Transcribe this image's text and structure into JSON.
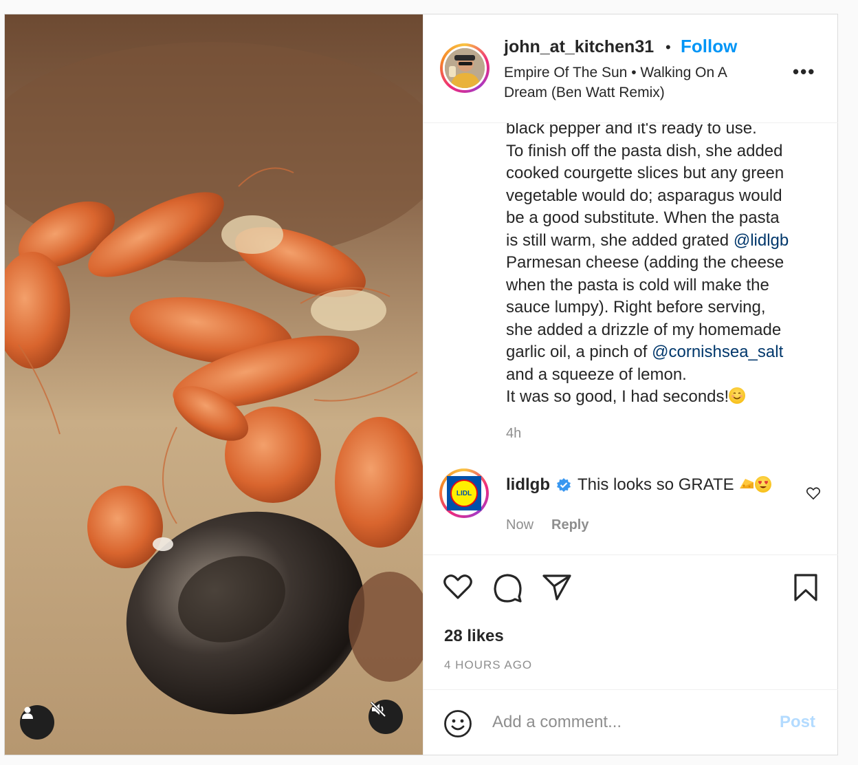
{
  "header": {
    "username": "john_at_kitchen31",
    "separator": "•",
    "follow_label": "Follow",
    "music": "Empire Of The Sun • Walking On A Dream (Ben Watt Remix)",
    "more_label": "•••"
  },
  "caption": {
    "lines": [
      "black pepper and it's ready to use.",
      "To finish off the pasta dish, she added",
      "cooked courgette slices but any green",
      "vegetable would do; asparagus would",
      "be a good substitute. When the pasta"
    ],
    "line6_pre": "is still warm, she added grated ",
    "mention1": "@lidlgb",
    "line7": "Parmesan cheese (adding the cheese",
    "line8": "when the pasta is cold will make the",
    "line9": "sauce lumpy). Right before serving,",
    "line10": "she added a drizzle of my homemade",
    "line11_pre": "garlic oil, a pinch of ",
    "mention2": "@cornishsea_salt",
    "line12": "and a squeeze of lemon.",
    "line13": "It was so good, I had seconds!",
    "time": "4h"
  },
  "comment": {
    "username": "lidlgb",
    "logo_text": "LIDL",
    "text": "This looks so GRATE ",
    "time": "Now",
    "reply_label": "Reply"
  },
  "actions": {
    "likes": "28 likes",
    "posted_ago": "4 HOURS AGO"
  },
  "add_comment": {
    "placeholder": "Add a comment...",
    "post_label": "Post"
  },
  "icons": {
    "tag": "user-tag-icon",
    "mute": "audio-muted-icon",
    "like": "heart-icon",
    "comment": "comment-bubble-icon",
    "share": "paper-plane-icon",
    "save": "bookmark-icon",
    "emoji": "smiley-icon",
    "verified": "verified-badge-icon"
  },
  "colors": {
    "accent": "#0095f6",
    "mention": "#00376b",
    "muted": "#8e8e8e",
    "post_disabled": "#b3dbff",
    "verified": "#3897f0"
  }
}
